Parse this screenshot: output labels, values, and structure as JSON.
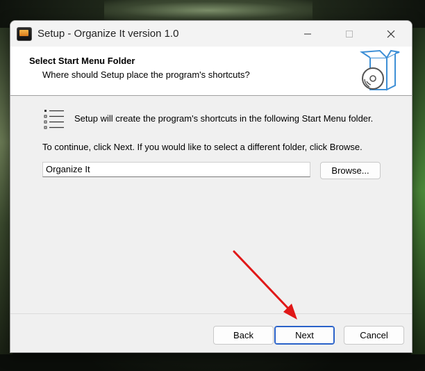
{
  "window": {
    "title": "Setup - Organize It version 1.0",
    "controls": [
      "minimize",
      "maximize",
      "close"
    ]
  },
  "header": {
    "title": "Select Start Menu Folder",
    "subtitle": "Where should Setup place the program's shortcuts?"
  },
  "body": {
    "intro": "Setup will create the program's shortcuts in the following Start Menu folder.",
    "instruction": "To continue, click Next. If you would like to select a different folder, click Browse.",
    "folder_value": "Organize It",
    "browse_label": "Browse..."
  },
  "footer": {
    "back_label": "Back",
    "next_label": "Next",
    "cancel_label": "Cancel"
  },
  "icons": {
    "app": "app-icon",
    "header": "software-box-cd-icon",
    "list": "list-icon"
  },
  "colors": {
    "annotation_arrow": "#e01818",
    "default_button_border": "#2a62c9"
  }
}
